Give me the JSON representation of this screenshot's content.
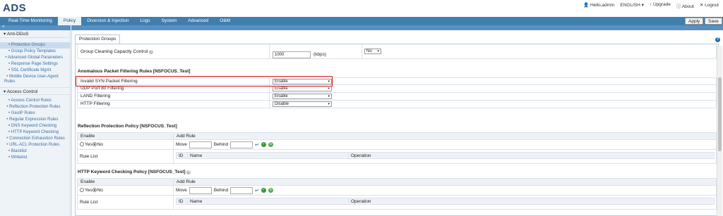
{
  "app": {
    "title": "ADS"
  },
  "userbar": {
    "greeting": "Hello,admin",
    "language": "ENGLISH",
    "upgrade": "Upgrade",
    "about": "About",
    "logout": "Logout"
  },
  "nav": {
    "tabs": [
      {
        "label": "Real-Time Monitoring",
        "active": false
      },
      {
        "label": "Policy",
        "active": true
      },
      {
        "label": "Diversion & Injection",
        "active": false
      },
      {
        "label": "Logs",
        "active": false
      },
      {
        "label": "System",
        "active": false
      },
      {
        "label": "Advanced",
        "active": false
      },
      {
        "label": "O&M",
        "active": false
      }
    ],
    "apply_label": "Apply",
    "save_label": "Save"
  },
  "sidebar": {
    "collapse_icon": "double-chevron-left-icon",
    "sections": [
      {
        "title": "Anti-DDoS",
        "items": [
          "Protection Groups",
          "Group Policy Templates",
          "Advanced Global Parameters",
          "Response Page Settings",
          "SSL Certificate Mgmt",
          "Mobile Device User-Agent Rules"
        ]
      },
      {
        "title": "Access Control",
        "items": [
          "Access Control Rules",
          "Reflection Protection Rules",
          "GeoIP Rules",
          "Regular Expression Rules",
          "DNS Keyword Checking",
          "HTTP Keyword Checking",
          "Connection Exhaustion Rules",
          "URL-ACL Protection Rules",
          "Blacklist",
          "Whitelist"
        ]
      }
    ],
    "selected": "Protection Groups"
  },
  "main": {
    "tab": "Protection Groups",
    "capacity": {
      "label": "Group Cleaning Capacity Control",
      "value": "1000",
      "unit": "(kbps)",
      "select": "No"
    },
    "anomalous": {
      "title": "Anomalous Packet Filtering Rules [NSFOCUS_Test]",
      "rows": [
        {
          "label": "Invalid SYN Packet Filtering",
          "value": "Enable"
        },
        {
          "label": "UDP Port 80 Filtering",
          "value": "Enable"
        },
        {
          "label": "LAND Filtering",
          "value": "Enable"
        },
        {
          "label": "HTTP Filtering",
          "value": "Disable"
        }
      ]
    },
    "reflection": {
      "title": "Reflection Protection Policy [NSFOCUS_Test]",
      "enable_header": "Enable",
      "addrule_header": "Add Rule",
      "yes": "Yes",
      "no": "No",
      "move": "Move",
      "behind": "Behind",
      "rule_list": "Rule List",
      "cols": [
        "ID",
        "Name",
        "Operation"
      ]
    },
    "http_keyword": {
      "title": "HTTP Keyword Checking Policy [NSFOCUS_Test]",
      "enable_header": "Enable",
      "addrule_header": "Add Rule",
      "yes": "Yes",
      "no": "No",
      "move": "Move",
      "behind": "Behind",
      "rule_list": "Rule List",
      "cols": [
        "ID",
        "Name",
        "Operation"
      ]
    }
  },
  "colors": {
    "nav_bg": "#3f7fb0",
    "highlight_border": "#dd1111",
    "logo": "#2a4a7a"
  }
}
